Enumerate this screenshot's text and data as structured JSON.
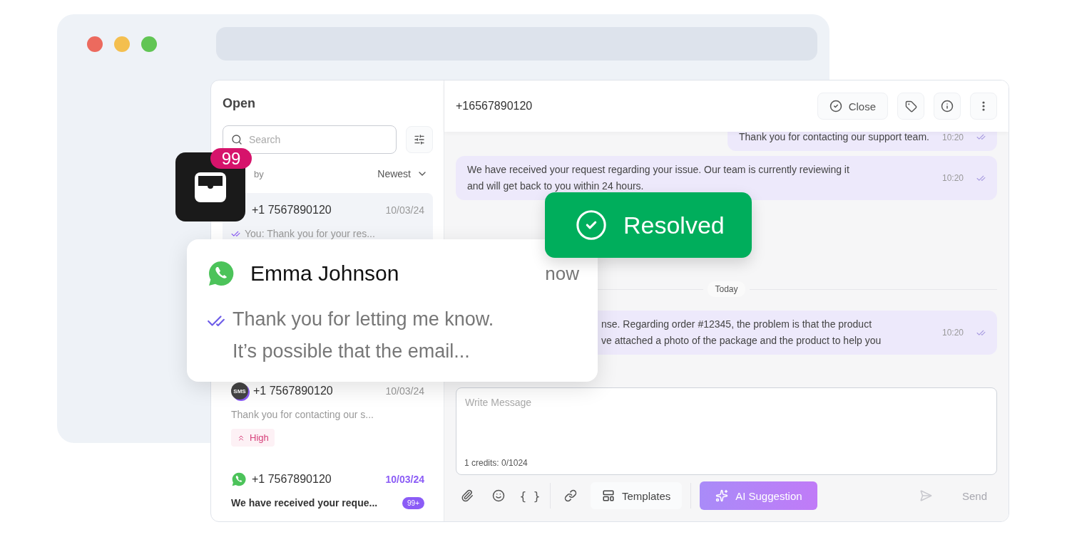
{
  "browser": {
    "dots": [
      {
        "color": "#ec6a5e"
      },
      {
        "color": "#f4bf4f"
      },
      {
        "color": "#61c554"
      }
    ]
  },
  "sidebar": {
    "title": "Open",
    "search": {
      "placeholder": "Search"
    },
    "sort_label": "by",
    "sort_value": "Newest",
    "conversations": [
      {
        "kind": "hidden",
        "phone": "+1 7567890120",
        "date": "10/03/24",
        "preview": "You: Thank you for your res...",
        "ticks": true,
        "selected": true,
        "unread": false
      },
      {
        "kind": "sms",
        "channel_label": "SMS",
        "phone": "+1 7567890120",
        "date": "10/03/24",
        "preview": "Thank you for contacting our s...",
        "ticks": false,
        "selected": false,
        "unread": false,
        "priority": "High"
      },
      {
        "kind": "whatsapp",
        "phone": "+1 7567890120",
        "date": "10/03/24",
        "preview": "We have received your reque...",
        "ticks": false,
        "selected": false,
        "unread": true,
        "count": "99+"
      }
    ]
  },
  "chat": {
    "contact": "+16567890120",
    "actions": [
      {
        "kind": "close",
        "label": "Close"
      },
      {
        "kind": "tag"
      },
      {
        "kind": "info"
      },
      {
        "kind": "more"
      }
    ],
    "items": [
      {
        "kind": "message",
        "outgoing": true,
        "lines": [
          "Thank you for contacting our support team."
        ],
        "time": "10:20"
      },
      {
        "kind": "message",
        "outgoing": false,
        "lines": [
          "We have received your request regarding your issue. Our team is currently reviewing it",
          "and will get back to you within 24 hours."
        ],
        "time": "10:20"
      },
      {
        "kind": "divider",
        "label": "Today"
      },
      {
        "kind": "message",
        "outgoing": false,
        "covered_left": true,
        "lines": [
          "nse. Regarding order #12345, the problem is that the product",
          "ve attached a photo of the package and the product to help you"
        ],
        "time": "10:20"
      }
    ]
  },
  "composer": {
    "placeholder": "Write Message",
    "credits": "1 credits: 0/1024",
    "tools": [
      {
        "kind": "attach"
      },
      {
        "kind": "emoji"
      },
      {
        "kind": "variables",
        "label": "{ }"
      },
      {
        "kind": "separator"
      },
      {
        "kind": "link"
      },
      {
        "kind": "templates",
        "label": "Templates"
      },
      {
        "kind": "separator"
      },
      {
        "kind": "ai",
        "label": "AI Suggestion"
      }
    ],
    "send": {
      "label": "Send",
      "disabled": true
    }
  },
  "inbox_badge": {
    "count": "99"
  },
  "notification": {
    "kind": "whatsapp",
    "name": "Emma Johnson",
    "time": "now",
    "ticks": true,
    "lines": [
      "Thank you for letting me know.",
      "It’s possible that the email..."
    ]
  },
  "toast": {
    "label": "Resolved"
  }
}
